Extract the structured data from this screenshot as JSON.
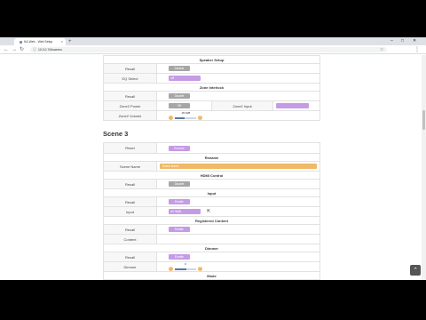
{
  "browser": {
    "tab_title": "KA-Web - Web Setup",
    "url": "10.0.0.7/#/scenes",
    "new_tab": "+",
    "window_buttons": [
      "–",
      "□",
      "✕"
    ]
  },
  "page": {
    "speaker_setup": {
      "title": "Speaker Setup",
      "recall_label": "Recall",
      "recall_button": "Disable",
      "eq_label": "EQ Select",
      "eq_value": "Off"
    },
    "zone_interlock": {
      "title": "Zone Interlock",
      "recall_label": "Recall",
      "recall_button": "Disable",
      "power_label": "Zone2 Power",
      "power_value": "Off",
      "input_label": "Zone2 Input",
      "input_value": "",
      "volume_label": "Zone2 Volume",
      "volume_value": "-35.5dB",
      "volume_level": 0.45
    },
    "scene3": {
      "heading": "Scene 3",
      "reset_label": "Reset",
      "reset_button": "Execute",
      "rename_title": "Rename",
      "scene_name_label": "Scene Name",
      "scene_name_value": "Scene Name",
      "hdmi_title": "HDMI Control",
      "hdmi_recall_label": "Recall",
      "hdmi_recall_button": "Disable",
      "input_title": "Input",
      "input_recall_label": "Recall",
      "input_recall_button": "Enable",
      "input_label": "Input",
      "input_value": "AV IN(B)",
      "registered_title": "Registered Content",
      "registered_recall_label": "Recall",
      "registered_recall_button": "Enable",
      "content_label": "Content",
      "dimmer_title": "Dimmer",
      "dimmer_recall_label": "Recall",
      "dimmer_recall_button": "Enable",
      "dimmer_label": "Dimmer",
      "dimmer_value": "0",
      "dimmer_level": 0.55,
      "mode_title": "Mode"
    }
  },
  "icons": {
    "back": "←",
    "forward": "→",
    "reload": "↻",
    "info": "ⓘ",
    "star": "☆",
    "menu": "⋮",
    "minus": "−",
    "plus": "+",
    "to_top": "⌃",
    "cursor": "⇱"
  },
  "colors": {
    "accent": "#c59be6",
    "disabled": "#a6a6a6",
    "name_field": "#f0b965"
  }
}
